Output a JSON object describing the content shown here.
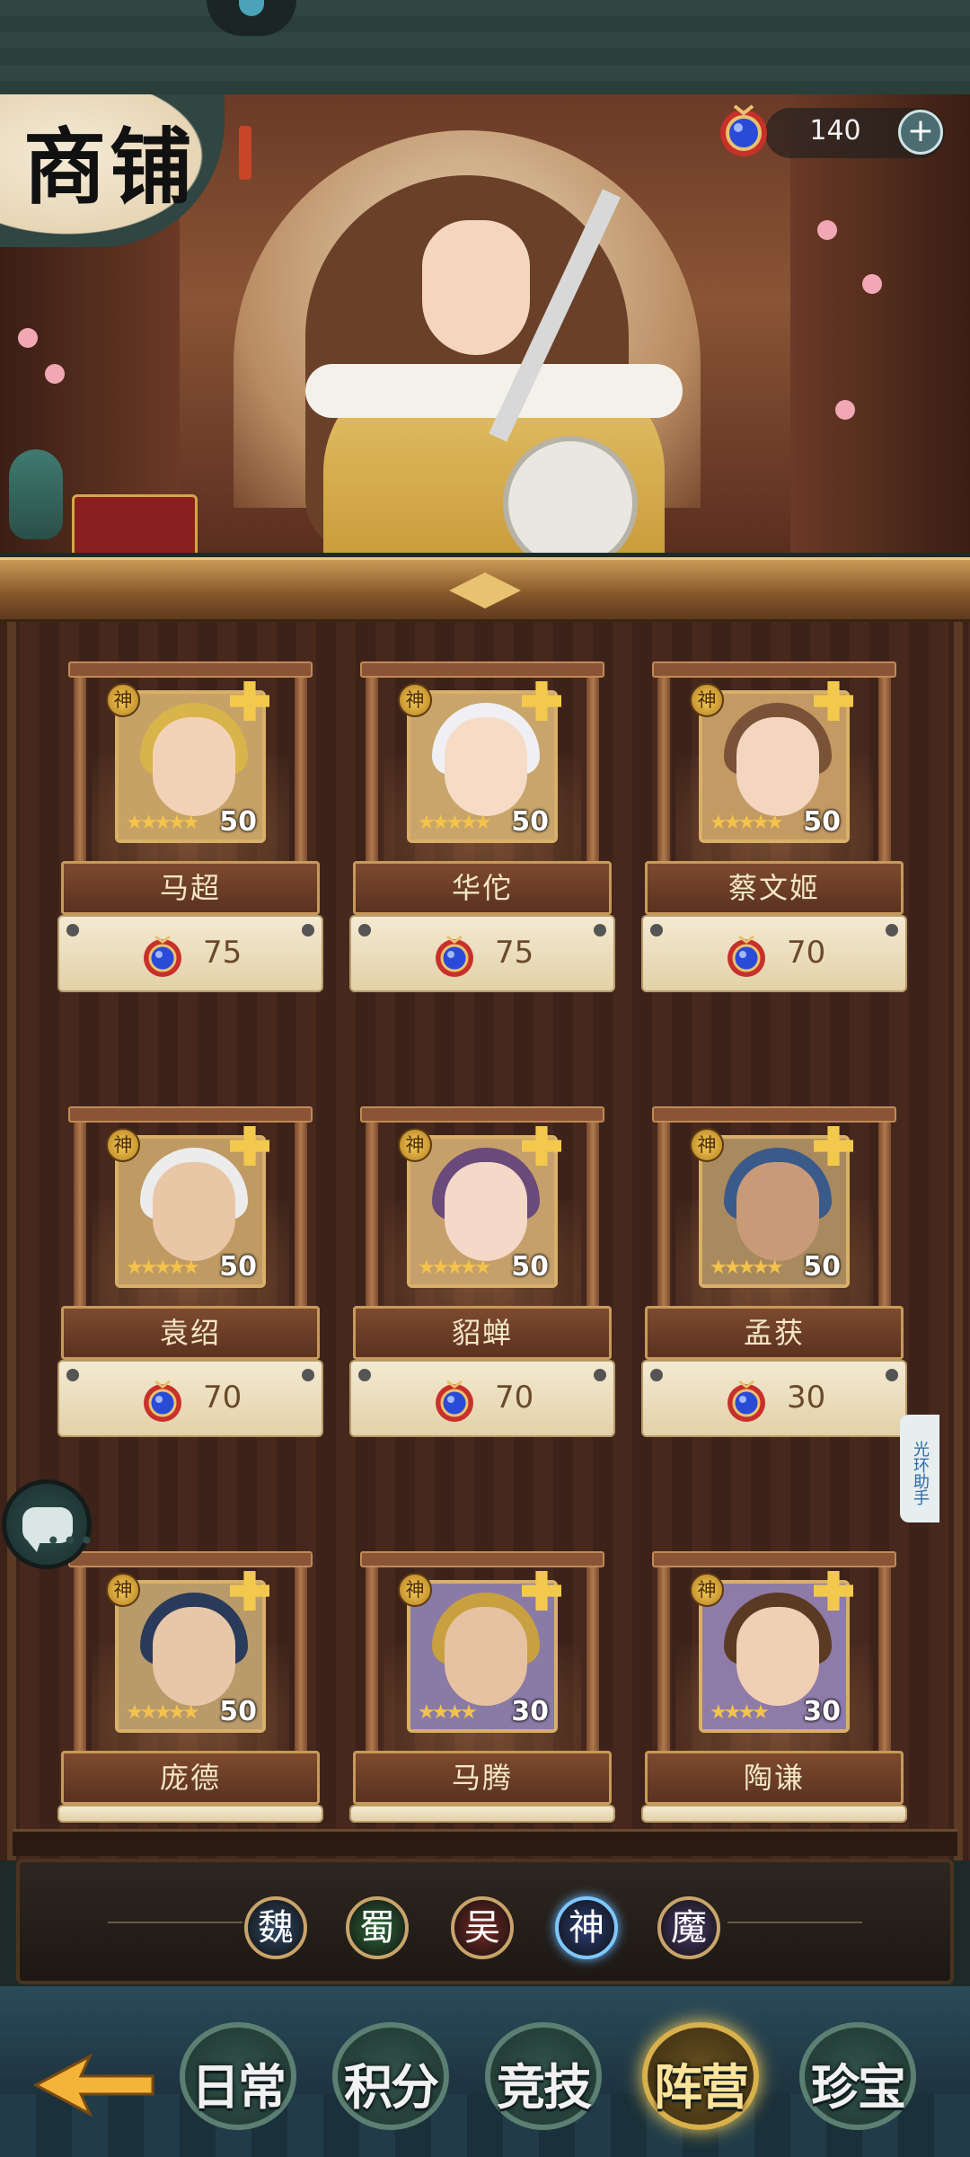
{
  "shop": {
    "title": "商铺",
    "currency": {
      "amount": "140",
      "plus": "+"
    },
    "cards": [
      {
        "name": "马超",
        "price": "75",
        "level": "50",
        "stars": "★★★★★",
        "badge": "神"
      },
      {
        "name": "华佗",
        "price": "75",
        "level": "50",
        "stars": "★★★★★",
        "badge": "神"
      },
      {
        "name": "蔡文姬",
        "price": "70",
        "level": "50",
        "stars": "★★★★★",
        "badge": "神"
      },
      {
        "name": "袁绍",
        "price": "70",
        "level": "50",
        "stars": "★★★★★",
        "badge": "神"
      },
      {
        "name": "貂蝉",
        "price": "70",
        "level": "50",
        "stars": "★★★★★",
        "badge": "神"
      },
      {
        "name": "孟获",
        "price": "30",
        "level": "50",
        "stars": "★★★★★",
        "badge": "神"
      },
      {
        "name": "庞德",
        "price": "",
        "level": "50",
        "stars": "★★★★★",
        "badge": "神"
      },
      {
        "name": "马腾",
        "price": "",
        "level": "30",
        "stars": "★★★★",
        "badge": "神"
      },
      {
        "name": "陶谦",
        "price": "",
        "level": "30",
        "stars": "★★★★",
        "badge": "神"
      }
    ]
  },
  "factions": [
    {
      "label": "魏",
      "color": "#2f4a66"
    },
    {
      "label": "蜀",
      "color": "#2f6a3a"
    },
    {
      "label": "吴",
      "color": "#7a2a24"
    },
    {
      "label": "神",
      "color": "#2a3e78",
      "active": true
    },
    {
      "label": "魔",
      "color": "#4a3a6a"
    }
  ],
  "nav": {
    "tabs": [
      {
        "label": "日常"
      },
      {
        "label": "积分"
      },
      {
        "label": "竞技"
      },
      {
        "label": "阵营",
        "active": true
      },
      {
        "label": "珍宝"
      }
    ]
  },
  "helper": {
    "label": "光环助手"
  },
  "colors": {
    "gold": "#d9b06a",
    "wood": "#5a321f",
    "parchment": "#f4ead2",
    "gem_blue": "#2a4ad8",
    "gem_red": "#c8302a"
  }
}
